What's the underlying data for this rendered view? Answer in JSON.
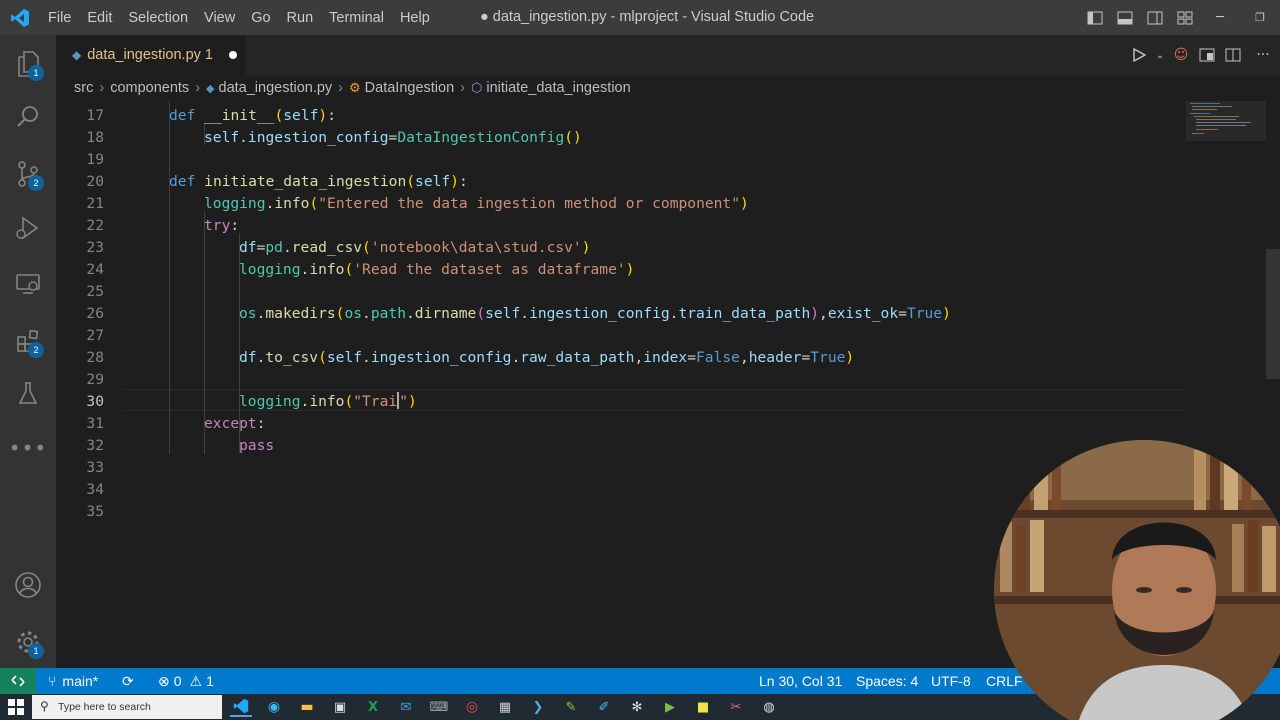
{
  "window": {
    "title": "● data_ingestion.py - mlproject - Visual Studio Code",
    "menu": [
      "File",
      "Edit",
      "Selection",
      "View",
      "Go",
      "Run",
      "Terminal",
      "Help"
    ]
  },
  "activity_bar": {
    "items": [
      {
        "name": "explorer",
        "badge": "1"
      },
      {
        "name": "search"
      },
      {
        "name": "source-control",
        "badge": "2"
      },
      {
        "name": "run-and-debug"
      },
      {
        "name": "remote-explorer"
      },
      {
        "name": "extensions",
        "badge": "2"
      },
      {
        "name": "testing"
      },
      {
        "name": "more"
      }
    ],
    "accounts": "accounts",
    "manage_badge": "1"
  },
  "tab": {
    "label": "data_ingestion.py 1",
    "modified": true
  },
  "breadcrumb": [
    "src",
    "components",
    "data_ingestion.py",
    "DataIngestion",
    "initiate_data_ingestion"
  ],
  "editor": {
    "lines": [
      {
        "n": "17"
      },
      {
        "n": "18"
      },
      {
        "n": "19"
      },
      {
        "n": "20"
      },
      {
        "n": "21"
      },
      {
        "n": "22"
      },
      {
        "n": "23"
      },
      {
        "n": "24"
      },
      {
        "n": "25"
      },
      {
        "n": "26"
      },
      {
        "n": "27"
      },
      {
        "n": "28"
      },
      {
        "n": "29"
      },
      {
        "n": "30"
      },
      {
        "n": "31"
      },
      {
        "n": "32"
      },
      {
        "n": "33"
      },
      {
        "n": "34"
      },
      {
        "n": "35"
      }
    ],
    "current_line": "30",
    "code": {
      "l17": {
        "kw": "def",
        "fn": "__init__",
        "p": "self"
      },
      "l18": {
        "var": "self.ingestion_config",
        "cls": "DataIngestionConfig"
      },
      "l20": {
        "kw": "def",
        "fn": "initiate_data_ingestion",
        "p": "self"
      },
      "l21": {
        "mod": "logging",
        "fn": "info",
        "str": "\"Entered the data ingestion method or component\""
      },
      "l22": {
        "kw": "try"
      },
      "l23": {
        "var": "df",
        "mod": "pd",
        "fn": "read_csv",
        "str": "'notebook\\data\\stud.csv'"
      },
      "l24": {
        "mod": "logging",
        "fn": "info",
        "str": "'Read the dataset as dataframe'"
      },
      "l26": {
        "a": "os",
        "b": "makedirs",
        "c": "os",
        "d": "path",
        "e": "dirname",
        "f": "self",
        "g": "ingestion_config",
        "h": "train_data_path",
        "i": "exist_ok",
        "j": "True"
      },
      "l28": {
        "a": "df",
        "b": "to_csv",
        "c": "self",
        "d": "ingestion_config",
        "e": "raw_data_path",
        "f": "index",
        "g": "False",
        "h": "header",
        "i": "True"
      },
      "l30": {
        "mod": "logging",
        "fn": "info",
        "str": "\"Trai"
      },
      "l31": {
        "kw": "except"
      },
      "l32": {
        "kw": "pass"
      }
    }
  },
  "status_bar": {
    "branch": "main*",
    "errors": "0",
    "warnings": "1",
    "position": "Ln 30, Col 31",
    "spaces": "Spaces: 4",
    "encoding": "UTF-8",
    "eol": "CRLF"
  },
  "taskbar": {
    "search_placeholder": "Type here to search"
  },
  "colors": {
    "statusbar": "#007acc",
    "activitybar": "#333333",
    "editor_bg": "#1e1e1e",
    "badge": "#0e639c"
  }
}
